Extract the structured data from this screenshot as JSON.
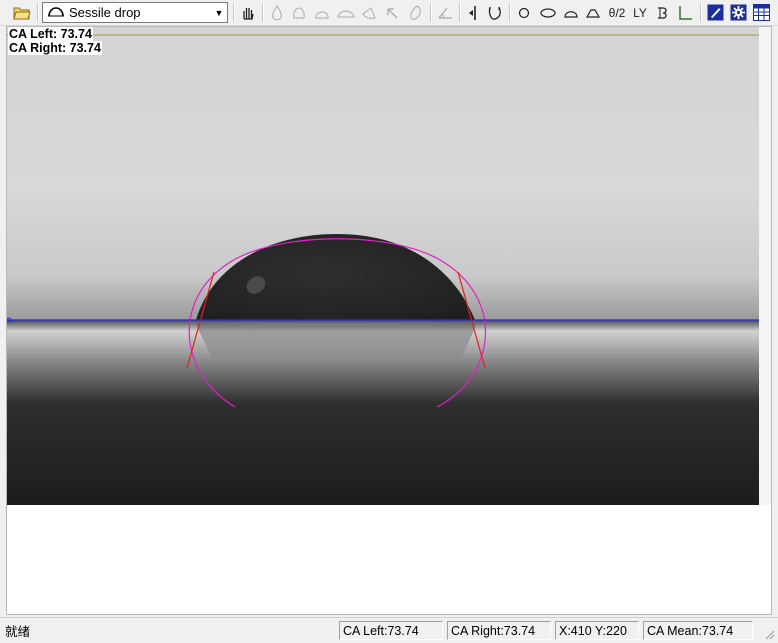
{
  "toolbar": {
    "method_select": {
      "selected": "Sessile drop"
    },
    "tools_text": {
      "theta_half": "θ/2",
      "ly": "LY"
    }
  },
  "overlay": {
    "ca_left": "CA Left: 73.74",
    "ca_right": "CA Right: 73.74"
  },
  "status_bar": {
    "ready": "就绪",
    "ca_left": "CA Left:73.74",
    "ca_right": "CA Right:73.74",
    "coords": "X:410 Y:220",
    "ca_mean": "CA Mean:73.74"
  },
  "colors": {
    "baseline": "#2b2bd6",
    "fit_curve": "#e020c8",
    "tangent": "#e02020",
    "selection": "#1d2f9e"
  }
}
